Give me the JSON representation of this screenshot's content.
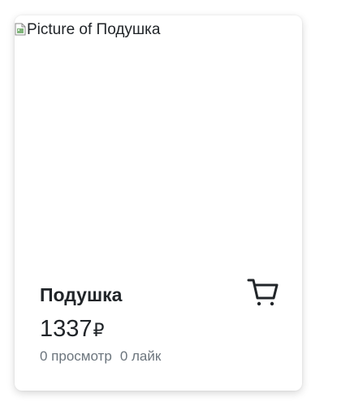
{
  "product": {
    "image_alt": "Picture of Подушка",
    "name": "Подушка",
    "price": "1337",
    "currency_symbol": "₽",
    "views_text": "0 просмотр",
    "likes_text": "0 лайк"
  },
  "icons": {
    "cart": "shopping-cart-icon",
    "broken_image": "broken-image-icon"
  },
  "colors": {
    "text": "#212529",
    "muted": "#6c757d",
    "card_bg": "#ffffff"
  }
}
